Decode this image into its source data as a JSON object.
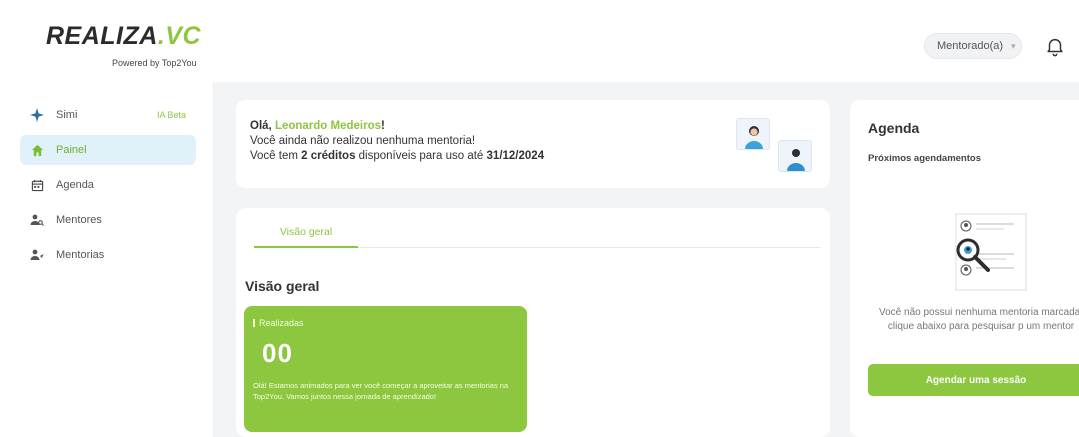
{
  "header": {
    "logo_main": "REALIZA",
    "logo_dot": ".",
    "logo_accent": "VC",
    "powered_by": "Powered by Top2You",
    "role_select": "Mentorado(a)",
    "bell_icon": "bell-icon"
  },
  "sidebar": {
    "items": [
      {
        "label": "Simi",
        "icon": "sparkle-icon",
        "badge": "IA Beta",
        "active": false
      },
      {
        "label": "Painel",
        "icon": "home-icon",
        "active": true
      },
      {
        "label": "Agenda",
        "icon": "calendar-icon",
        "active": false
      },
      {
        "label": "Mentores",
        "icon": "mentor-search-icon",
        "active": false
      },
      {
        "label": "Mentorias",
        "icon": "mentoring-icon",
        "active": false
      }
    ]
  },
  "welcome": {
    "greeting": "Olá, ",
    "user_name": "Leonardo Medeiros",
    "greeting_end": "!",
    "no_mentoring": "Você ainda não realizou nenhuma mentoria!",
    "credits_pre": "Você tem ",
    "credits_value": "2 créditos",
    "credits_mid": " disponíveis para uso até ",
    "credits_date": "31/12/2024"
  },
  "overview": {
    "tab_label": "Visão geral",
    "section_title": "Visão geral",
    "stat": {
      "label": "Realizadas",
      "value": "00",
      "description": "Olá! Estamos animados para ver você começar a aproveitar as mentorias na Top2You. Vamos juntos nessa jornada de aprendizado!"
    }
  },
  "agenda": {
    "title": "Agenda",
    "subtitle": "Próximos agendamentos",
    "empty_message": "Você não possui nenhuma mentoria marcada, clique abaixo para pesquisar p um mentor",
    "cta": "Agendar uma sessão"
  },
  "colors": {
    "brand_green": "#8dc63f",
    "active_nav_bg": "#e1f1fa",
    "page_bg": "#f3f4f6"
  }
}
